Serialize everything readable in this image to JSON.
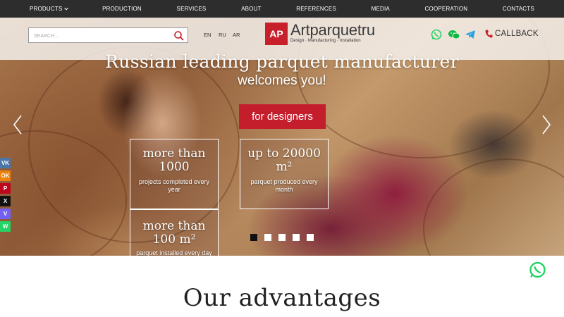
{
  "nav": {
    "items": [
      {
        "label": "PRODUCTS",
        "dropdown": true
      },
      {
        "label": "PRODUCTION"
      },
      {
        "label": "SERVICES"
      },
      {
        "label": "ABOUT"
      },
      {
        "label": "REFERENCES"
      },
      {
        "label": "MEDIA"
      },
      {
        "label": "COOPERATION"
      },
      {
        "label": "CONTACTS"
      }
    ]
  },
  "header": {
    "search_placeholder": "SEARCH...",
    "languages": [
      "EN",
      "RU",
      "AR"
    ],
    "logo": {
      "mark": "AP",
      "name": "Artparquetru",
      "tagline": "Design · Manufacturing · Installation"
    },
    "contact_icons": [
      "whatsapp-icon",
      "wechat-icon",
      "telegram-icon"
    ],
    "callback_label": "CALLBACK"
  },
  "hero": {
    "title": "Russian leading parquet manufacturer",
    "subtitle": "welcomes you!",
    "cta_label": "for designers",
    "stats": [
      {
        "big": "more than 1000",
        "small": "projects completed every year"
      },
      {
        "big": "up to 20000 m²",
        "small": "parquet produced every month"
      },
      {
        "big": "more than 100 m²",
        "small": "parquet installed every day"
      }
    ],
    "slides_count": 5,
    "active_slide": 1
  },
  "social_share": [
    "VK",
    "OK",
    "P",
    "X",
    "V",
    "W"
  ],
  "advantages": {
    "title": "Our advantages"
  },
  "colors": {
    "accent": "#c41e2c",
    "nav_bg": "#2d2d2d",
    "whatsapp": "#25d366",
    "wechat": "#09b83e",
    "telegram": "#2aa2de"
  }
}
